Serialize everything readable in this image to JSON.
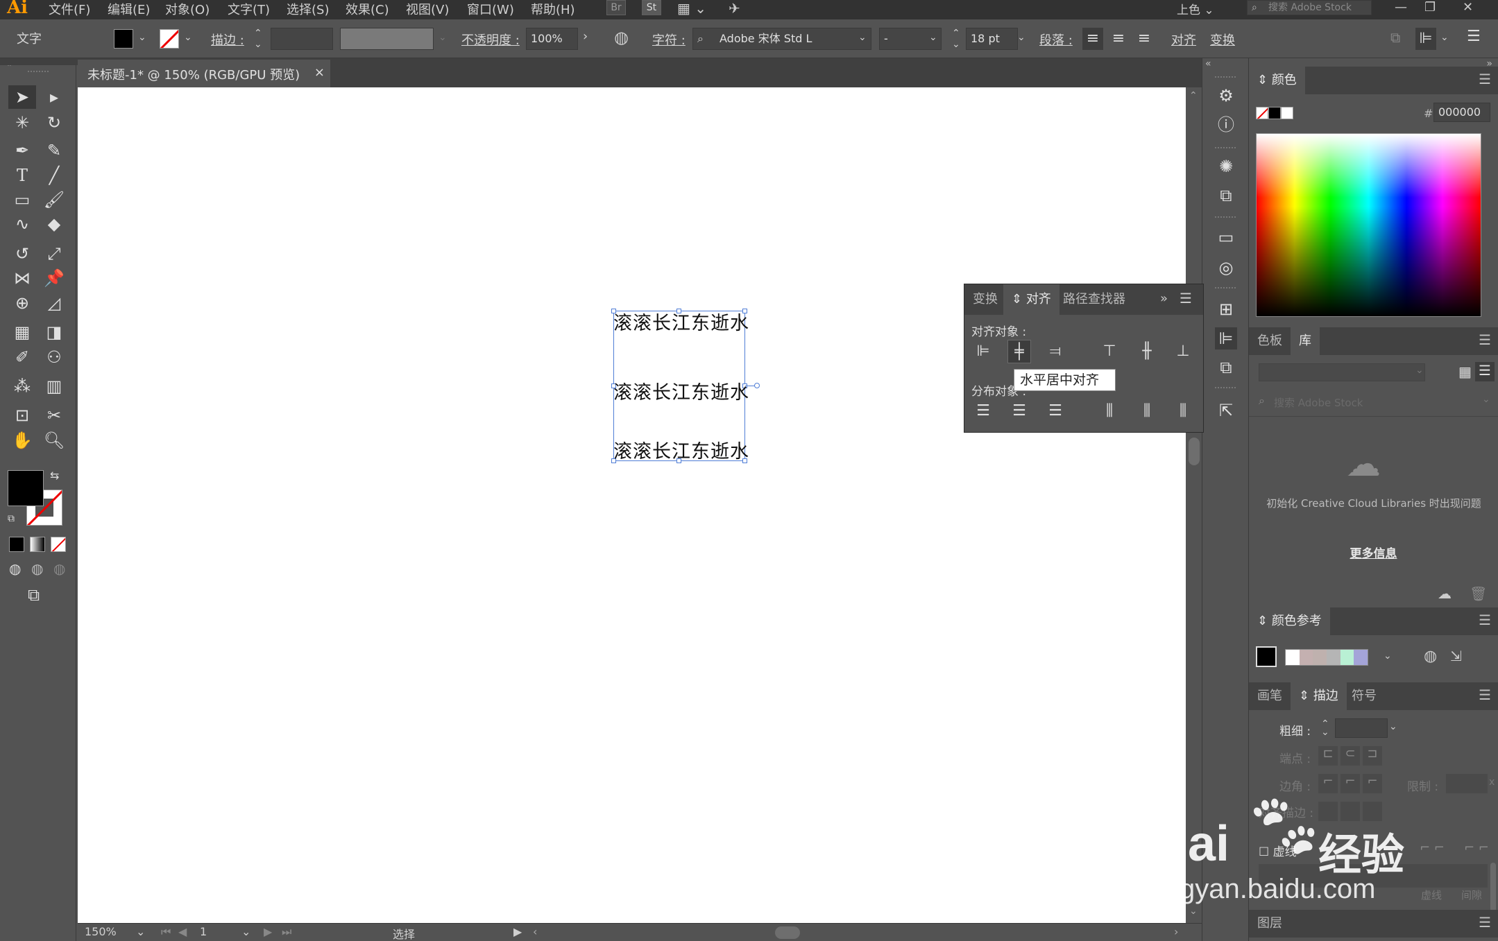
{
  "app": {
    "logo": "Ai"
  },
  "menubar": {
    "items": [
      "文件(F)",
      "编辑(E)",
      "对象(O)",
      "文字(T)",
      "选择(S)",
      "效果(C)",
      "视图(V)",
      "窗口(W)",
      "帮助(H)"
    ],
    "br_label": "Br",
    "st_label": "St",
    "workspace": "上色",
    "search_placeholder": "搜索 Adobe Stock"
  },
  "controlbar": {
    "mode_label": "文字",
    "stroke_label": "描边 :",
    "opacity_label": "不透明度 :",
    "opacity_value": "100%",
    "char_label": "字符 :",
    "font_name": "Adobe 宋体 Std L",
    "font_style": "-",
    "font_size": "18 pt",
    "para_label": "段落 :",
    "align_label": "对齐",
    "transform_label": "变换"
  },
  "document": {
    "tab_title": "未标题-1* @ 150% (RGB/GPU 预览)",
    "close_glyph": "×"
  },
  "canvas": {
    "text_lines": [
      "滚滚长江东逝水",
      "滚滚长江东逝水",
      "滚滚长江东逝水"
    ]
  },
  "statusbar": {
    "zoom": "150%",
    "page": "1",
    "mode": "选择"
  },
  "align_panel": {
    "tabs": [
      "变换",
      "对齐",
      "路径查找器"
    ],
    "align_objects_label": "对齐对象 :",
    "distribute_objects_label": "分布对象 :",
    "tooltip": "水平居中对齐"
  },
  "color_panel": {
    "title": "颜色",
    "hex_symbol": "#",
    "hex_value": "000000"
  },
  "library_panel": {
    "tabs": [
      "色板",
      "库"
    ],
    "search_placeholder": "搜索 Adobe Stock",
    "message": "初始化 Creative Cloud Libraries 时出现问题",
    "more_info": "更多信息"
  },
  "color_guide_panel": {
    "title": "颜色参考",
    "swatches": [
      "#ffffff",
      "#c4b0b0",
      "#bfb1ae",
      "#b5b5b5",
      "#b9f0d4",
      "#a4a4d8"
    ]
  },
  "stroke_panel": {
    "tabs": [
      "画笔",
      "描边",
      "符号"
    ],
    "weight_label": "粗细 :",
    "cap_label": "端点 :",
    "corner_label": "边角 :",
    "limit_label": "限制 :",
    "align_label": "对齐描边 :",
    "dashed_label": "虚线",
    "dash_label": "虚线",
    "gap_label": "间隙",
    "x_glyph": "x"
  },
  "layers_panel": {
    "title": "图层"
  },
  "watermark": {
    "brand": "Bai",
    "brand_cn": "经验",
    "url": "jingyan.baidu.com"
  },
  "colors": {
    "ui_bg": "#535353",
    "dark_bg": "#323232",
    "selection": "#4f7dd6",
    "logo": "#ff9a00"
  }
}
